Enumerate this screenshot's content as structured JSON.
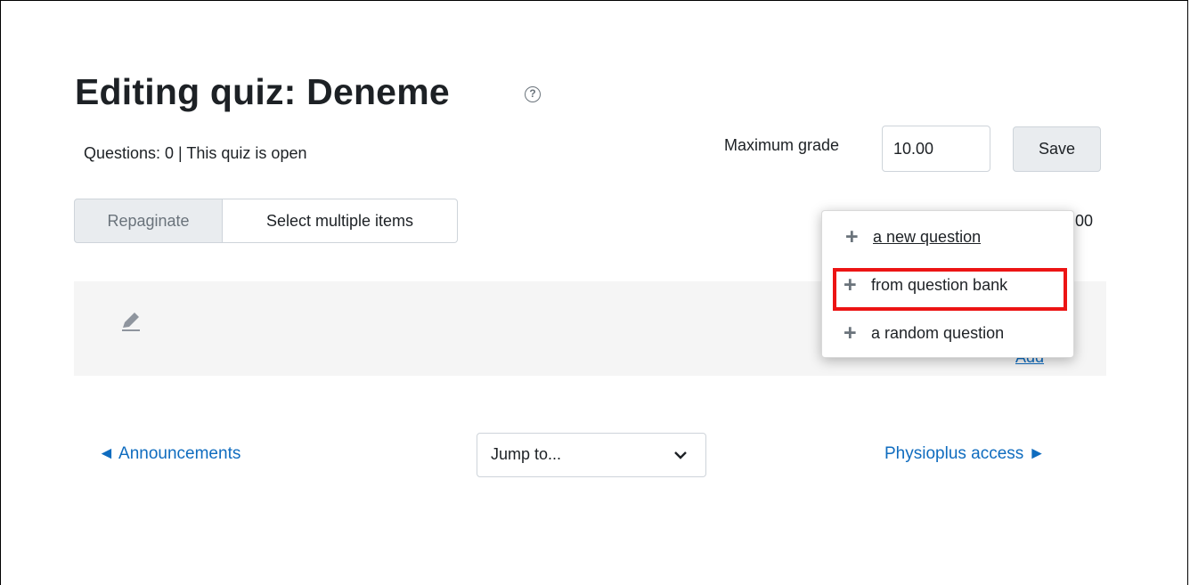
{
  "page": {
    "title": "Editing quiz: Deneme",
    "help_icon": "question-circle-icon",
    "status_text": "Questions: 0 | This quiz is open"
  },
  "grade": {
    "label": "Maximum grade",
    "value": "10.00",
    "save_label": "Save"
  },
  "toolbar": {
    "repaginate_label": "Repaginate",
    "select_multiple_label": "Select multiple items",
    "total_marks_fragment": "00"
  },
  "section": {
    "edit_icon": "pencil-icon",
    "add_link_fragment": "Add"
  },
  "add_menu": {
    "items": [
      {
        "icon": "plus-icon",
        "label": "a new question"
      },
      {
        "icon": "plus-icon",
        "label": "from question bank",
        "highlighted": true
      },
      {
        "icon": "plus-icon",
        "label": "a random question"
      }
    ]
  },
  "navigation": {
    "prev_label": "◄ Announcements",
    "jump_label": "Jump to...",
    "next_label": "Physioplus access ►"
  },
  "colors": {
    "link": "#0f6cbf",
    "highlight": "#ec1414",
    "section_bg": "#f5f5f5"
  }
}
